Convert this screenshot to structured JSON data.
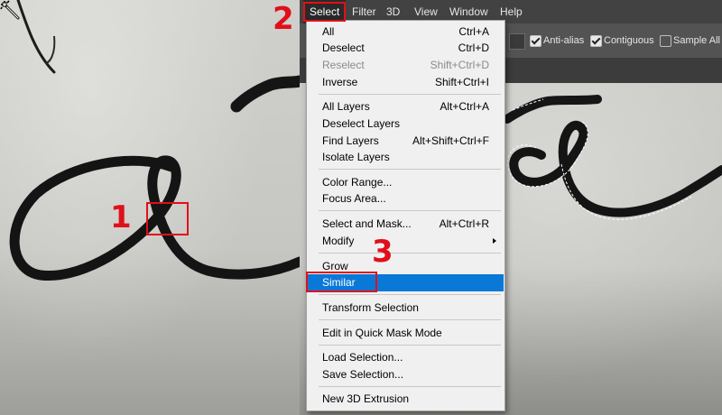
{
  "menubar": {
    "items": [
      {
        "label": "Select",
        "active": true
      },
      {
        "label": "Filter"
      },
      {
        "label": "3D"
      },
      {
        "label": "View"
      },
      {
        "label": "Window"
      },
      {
        "label": "Help"
      }
    ]
  },
  "options_bar": {
    "anti_alias_label": "Anti-alias",
    "contiguous_label": "Contiguous",
    "sample_all_label": "Sample All L"
  },
  "select_menu": {
    "items": [
      {
        "label": "All",
        "shortcut": "Ctrl+A"
      },
      {
        "label": "Deselect",
        "shortcut": "Ctrl+D"
      },
      {
        "label": "Reselect",
        "shortcut": "Shift+Ctrl+D",
        "disabled": true
      },
      {
        "label": "Inverse",
        "shortcut": "Shift+Ctrl+I"
      },
      {
        "label": "All Layers",
        "shortcut": "Alt+Ctrl+A"
      },
      {
        "label": "Deselect Layers",
        "shortcut": ""
      },
      {
        "label": "Find Layers",
        "shortcut": "Alt+Shift+Ctrl+F"
      },
      {
        "label": "Isolate Layers",
        "shortcut": ""
      },
      {
        "label": "Color Range...",
        "shortcut": ""
      },
      {
        "label": "Focus Area...",
        "shortcut": ""
      },
      {
        "label": "Select and Mask...",
        "shortcut": "Alt+Ctrl+R"
      },
      {
        "label": "Modify",
        "shortcut": ""
      },
      {
        "label": "Grow",
        "shortcut": ""
      },
      {
        "label": "Similar",
        "shortcut": "",
        "highlighted": true
      },
      {
        "label": "Transform Selection",
        "shortcut": ""
      },
      {
        "label": "Edit in Quick Mask Mode",
        "shortcut": ""
      },
      {
        "label": "Load Selection...",
        "shortcut": ""
      },
      {
        "label": "Save Selection...",
        "shortcut": ""
      },
      {
        "label": "New 3D Extrusion",
        "shortcut": ""
      }
    ]
  },
  "annotations": {
    "step1": "1",
    "step2": "2",
    "step3": "3"
  },
  "colors": {
    "annotation_red": "#e0101a",
    "highlight_blue": "#0a78d7",
    "menubar_bg": "#424242",
    "menu_bg": "#f0f0f0"
  },
  "icons": {
    "tool_cursor": "magic-wand-cursor-icon",
    "submenu": "chevron-right-icon"
  }
}
